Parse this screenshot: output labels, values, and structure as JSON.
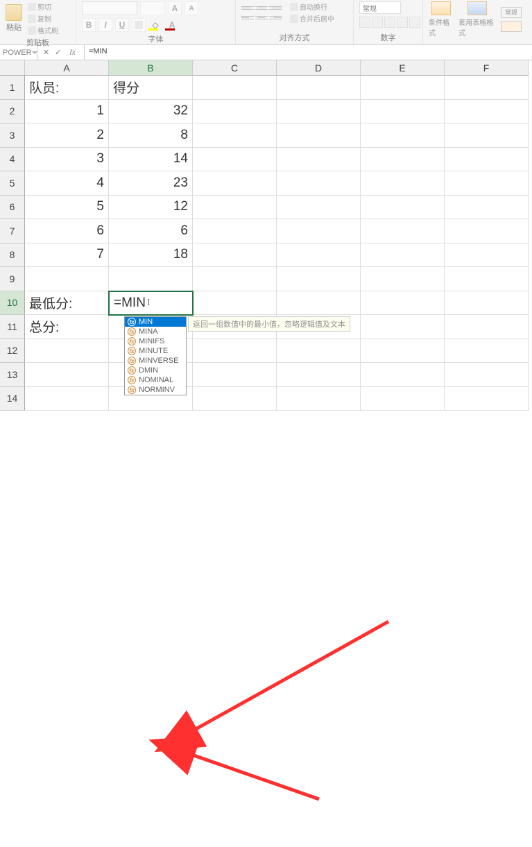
{
  "ribbon": {
    "clipboard": {
      "group_label": "剪贴板",
      "paste": "粘贴",
      "cut": "剪切",
      "copy": "复制",
      "format_painter": "格式刷"
    },
    "font": {
      "group_label": "字体",
      "bold": "B",
      "italic": "I",
      "underline": "U"
    },
    "alignment": {
      "group_label": "对齐方式",
      "wrap": "自动换行",
      "merge": "合并后居中"
    },
    "number": {
      "group_label": "数字",
      "format_value": "常规"
    },
    "styles": {
      "conditional": "条件格式",
      "table_style": "套用表格格式",
      "cell_group": "常规"
    }
  },
  "formula_bar": {
    "cell_name": "POWER",
    "cancel_symbol": "✕",
    "confirm_symbol": "✓",
    "fx": "fx",
    "formula_value": "=MIN"
  },
  "grid": {
    "columns": [
      "A",
      "B",
      "C",
      "D",
      "E",
      "F"
    ],
    "rows": [
      "1",
      "2",
      "3",
      "4",
      "5",
      "6",
      "7",
      "8",
      "9",
      "10",
      "11",
      "12",
      "13",
      "14"
    ],
    "active_cell": {
      "row": 10,
      "col": "B",
      "display": "=MIN"
    },
    "data": {
      "A1": "队员:",
      "B1": "得分",
      "A2": "1",
      "B2": "32",
      "A3": "2",
      "B3": "8",
      "A4": "3",
      "B4": "14",
      "A5": "4",
      "B5": "23",
      "A6": "5",
      "B6": "12",
      "A7": "6",
      "B7": "6",
      "A8": "7",
      "B8": "18",
      "A10": "最低分:",
      "A11": "总分:"
    }
  },
  "autocomplete": {
    "tooltip": "返回一组数值中的最小值，忽略逻辑值及文本",
    "selected_index": 0,
    "items": [
      "MIN",
      "MINA",
      "MINIFS",
      "MINUTE",
      "MINVERSE",
      "DMIN",
      "NOMINAL",
      "NORMINV"
    ]
  }
}
